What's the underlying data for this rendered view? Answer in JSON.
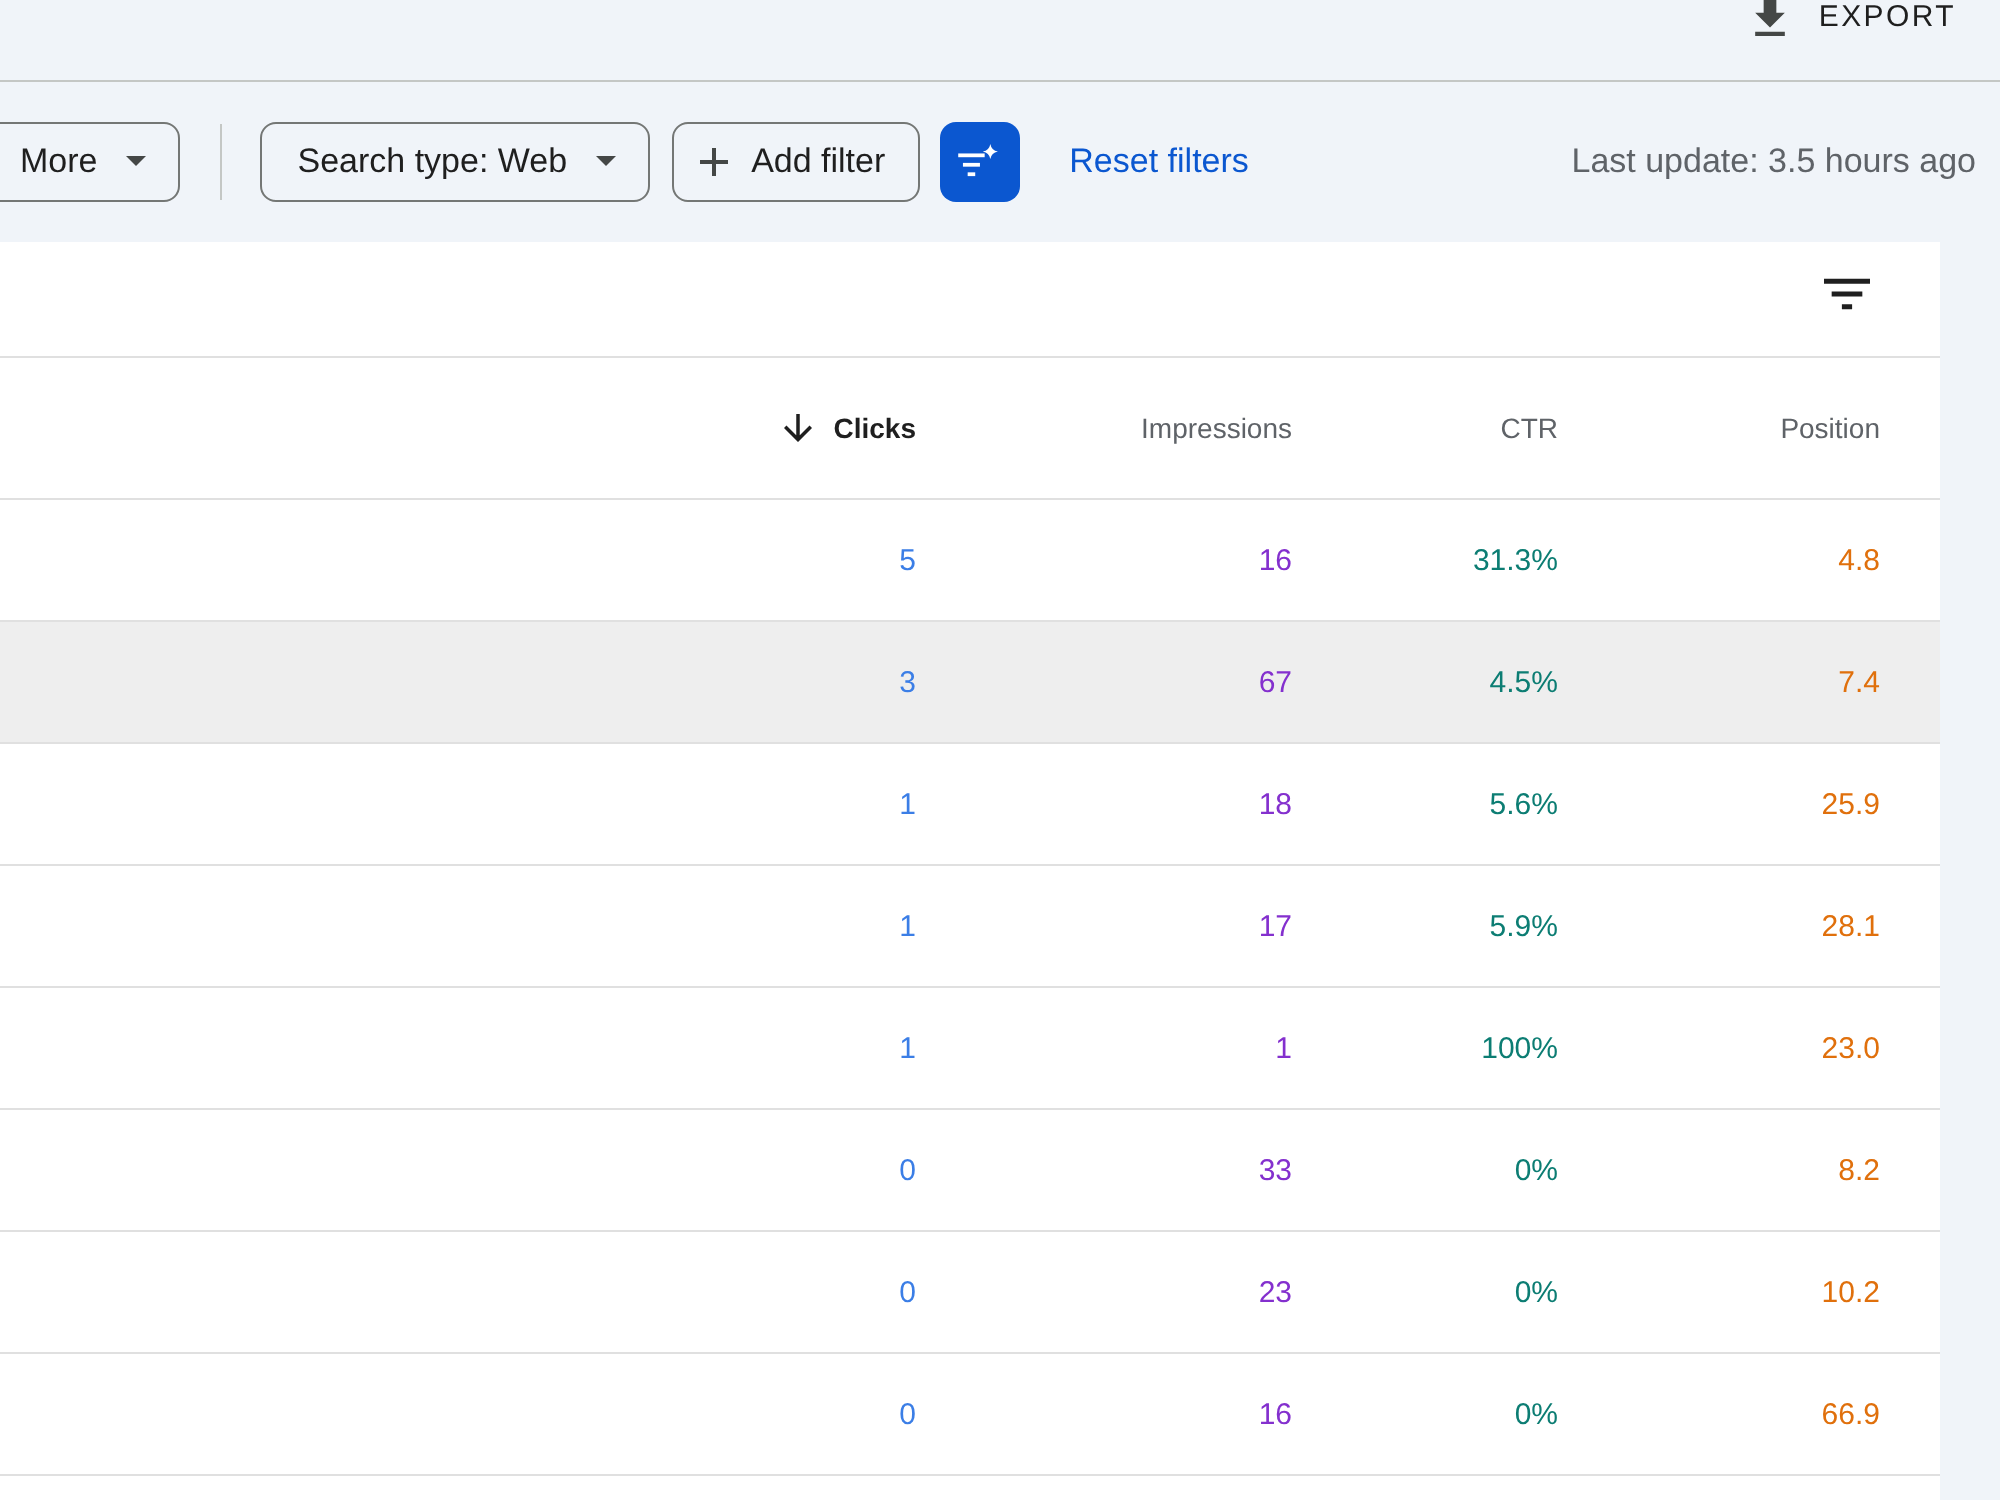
{
  "export": {
    "label": "EXPORT"
  },
  "filters": {
    "more_button": {
      "label": "More"
    },
    "chips": [
      {
        "kind": "dropdown",
        "label": "Search type: Web"
      },
      {
        "kind": "add",
        "label": "Add filter"
      }
    ],
    "reset_link": "Reset filters",
    "last_update": "Last update: 3.5 hours ago"
  },
  "table": {
    "columns": [
      {
        "label": "Clicks",
        "sorted": true,
        "color": "#3b7ee6"
      },
      {
        "label": "Impressions",
        "sorted": false,
        "color": "#8430ce"
      },
      {
        "label": "CTR",
        "sorted": false,
        "color": "#0c7d73"
      },
      {
        "label": "Position",
        "sorted": false,
        "color": "#e0700c"
      }
    ],
    "rows": [
      {
        "cells": [
          "5",
          "16",
          "31.3%",
          "4.8"
        ],
        "highlighted": false
      },
      {
        "cells": [
          "3",
          "67",
          "4.5%",
          "7.4"
        ],
        "highlighted": true
      },
      {
        "cells": [
          "1",
          "18",
          "5.6%",
          "25.9"
        ],
        "highlighted": false
      },
      {
        "cells": [
          "1",
          "17",
          "5.9%",
          "28.1"
        ],
        "highlighted": false
      },
      {
        "cells": [
          "1",
          "1",
          "100%",
          "23.0"
        ],
        "highlighted": false
      },
      {
        "cells": [
          "0",
          "33",
          "0%",
          "8.2"
        ],
        "highlighted": false
      },
      {
        "cells": [
          "0",
          "23",
          "0%",
          "10.2"
        ],
        "highlighted": false
      },
      {
        "cells": [
          "0",
          "16",
          "0%",
          "66.9"
        ],
        "highlighted": false
      }
    ]
  }
}
